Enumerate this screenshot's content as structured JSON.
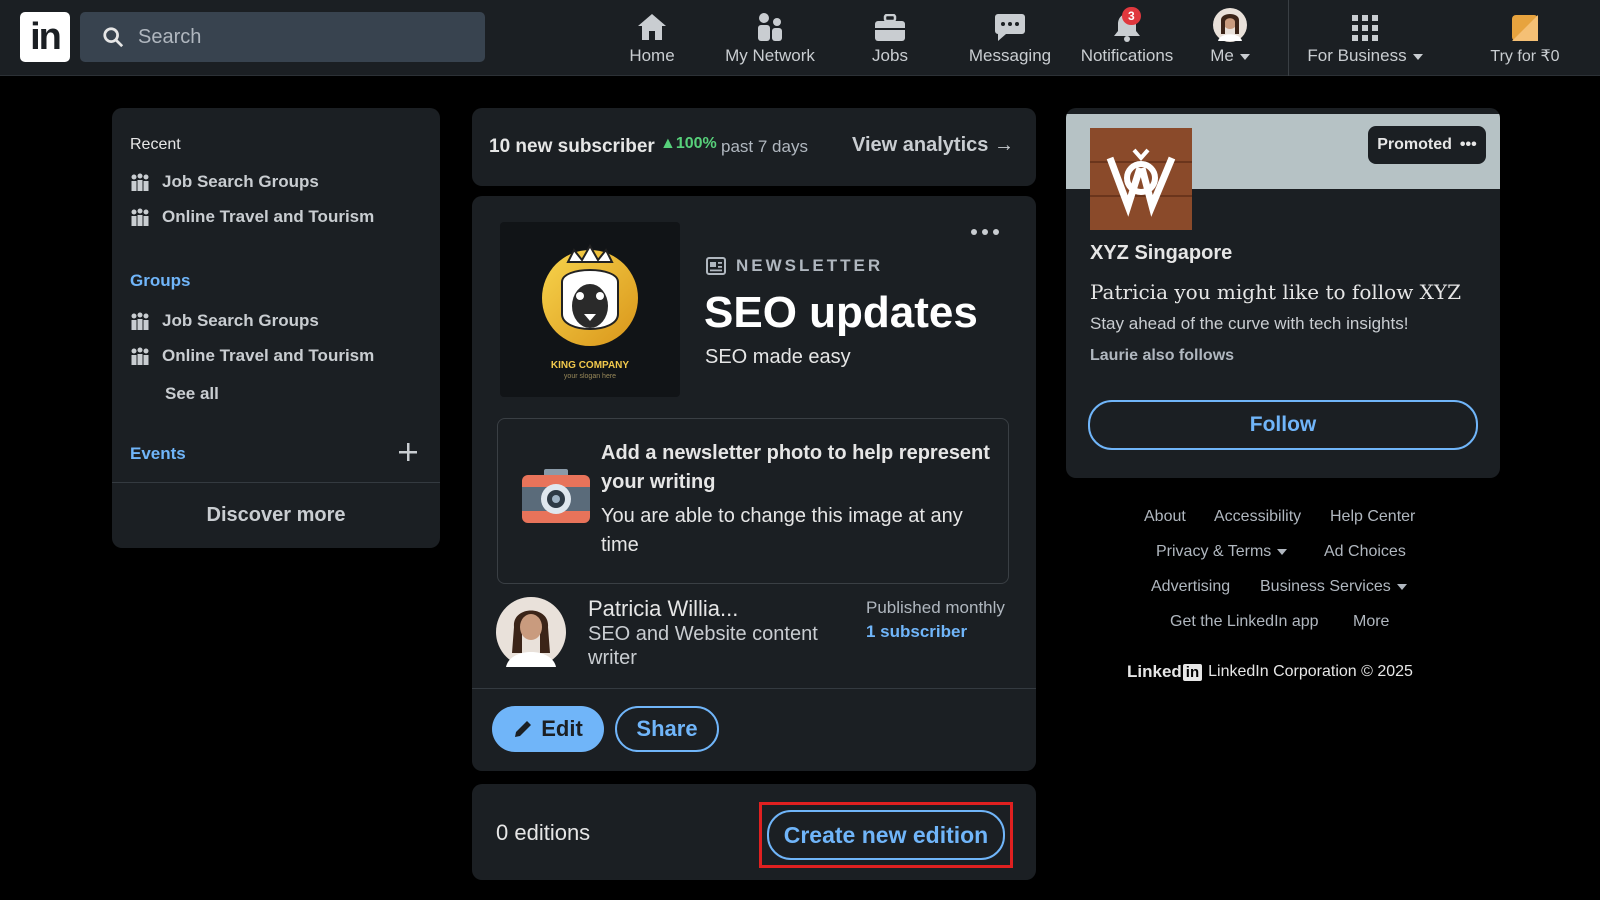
{
  "topbar": {
    "search_placeholder": "Search",
    "nav": [
      {
        "label": "Home"
      },
      {
        "label": "My Network"
      },
      {
        "label": "Jobs"
      },
      {
        "label": "Messaging"
      },
      {
        "label": "Notifications",
        "badge": "3"
      },
      {
        "label": "Me"
      },
      {
        "label": "For Business"
      },
      {
        "label": "Try for ₹0"
      }
    ]
  },
  "sidebar": {
    "recent_heading": "Recent",
    "recent": [
      "Job Search Groups",
      "Online Travel and Tourism"
    ],
    "groups_heading": "Groups",
    "groups": [
      "Job Search Groups",
      "Online Travel and Tourism"
    ],
    "see_all": "See all",
    "events_heading": "Events",
    "discover_more": "Discover more"
  },
  "analytics": {
    "subscribers": "10 new subscriber",
    "growth": "100%",
    "period": "past 7 days",
    "view_analytics": "View analytics"
  },
  "newsletter": {
    "logo_text": "KING COMPANY",
    "logo_sub": "your slogan here",
    "kicker": "NEWSLETTER",
    "title": "SEO updates",
    "subtitle": "SEO made easy",
    "photo_prompt_title": "Add a newsletter photo to help represent your writing",
    "photo_prompt_body": "You are able to change this image at any time",
    "author_name": "Patricia Willia...",
    "author_headline": "SEO and Website content writer",
    "frequency": "Published monthly",
    "subscriber_count": "1 subscriber",
    "edit_label": "Edit",
    "share_label": "Share"
  },
  "editions": {
    "count_label": "0 editions",
    "create_label": "Create new edition"
  },
  "ad": {
    "promoted": "Promoted",
    "company": "XYZ Singapore",
    "headline": "Patricia you might like to follow XYZ",
    "body": "Stay ahead of the curve with tech insights!",
    "social": "Laurie also follows",
    "follow_label": "Follow"
  },
  "footer": {
    "links_row1": [
      "About",
      "Accessibility",
      "Help Center"
    ],
    "links_row2": [
      "Privacy & Terms",
      "Ad Choices"
    ],
    "links_row3": [
      "Advertising",
      "Business Services"
    ],
    "links_row4": [
      "Get the LinkedIn app",
      "More"
    ],
    "brand": "Linked",
    "copyright": "LinkedIn Corporation © 2025"
  },
  "colors": {
    "accent_blue": "#70b5f9",
    "growth_green": "#57d07a",
    "highlight_red": "#e02020",
    "card_bg": "#1b1f23"
  }
}
